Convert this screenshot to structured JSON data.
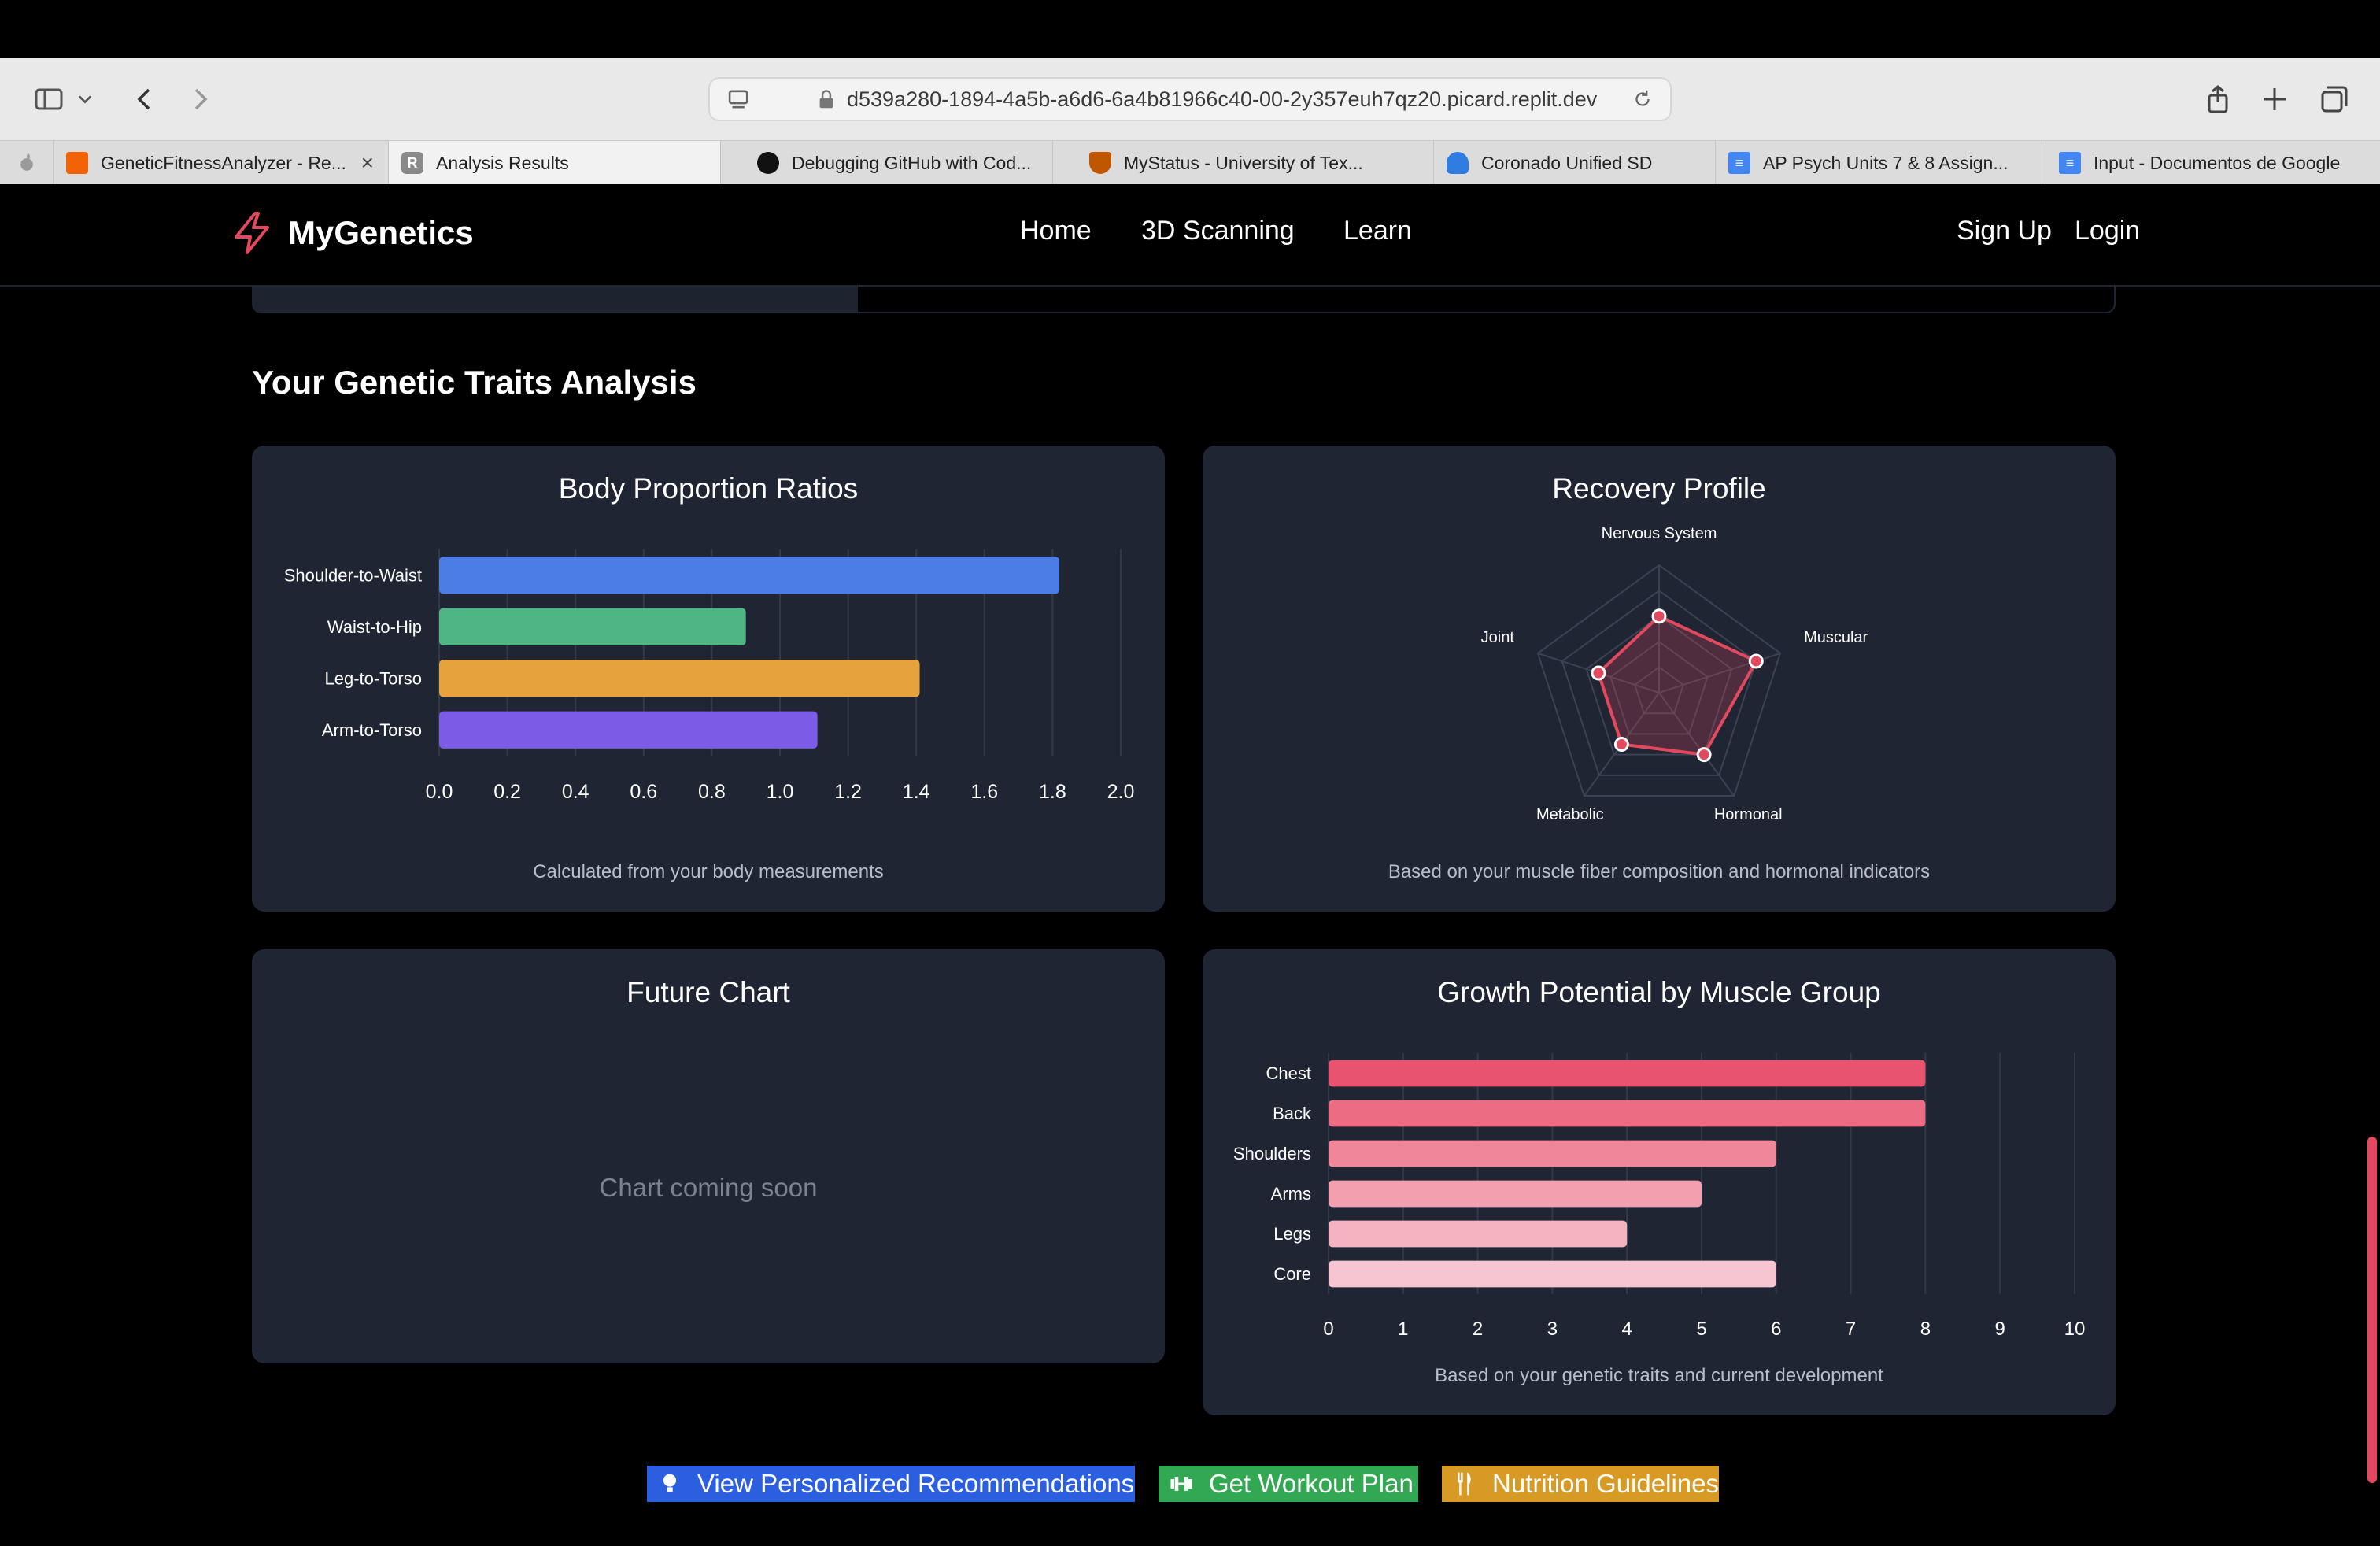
{
  "browser": {
    "url": "d539a280-1894-4a5b-a6d6-6a4b81966c40-00-2y357euh7qz20.picard.replit.dev",
    "tabs": [
      {
        "label": "GeneticFitnessAnalyzer - Re...",
        "favicon": "replit-icon",
        "color": "#f26207"
      },
      {
        "label": "Analysis Results",
        "favicon": "r-icon",
        "color": "#8a8a8a"
      },
      {
        "label": "Debugging GitHub with Cod...",
        "favicon": "openai-icon",
        "color": "#111111"
      },
      {
        "label": "MyStatus - University of Tex...",
        "favicon": "shield-icon",
        "color": "#bf5700"
      },
      {
        "label": "Coronado Unified SD",
        "favicon": "cloud-icon",
        "color": "#2f7de1"
      },
      {
        "label": "AP Psych Units 7 & 8 Assign...",
        "favicon": "docs-icon",
        "color": "#4285f4"
      },
      {
        "label": "Input - Documentos de Google",
        "favicon": "docs-icon",
        "color": "#4285f4"
      }
    ]
  },
  "nav": {
    "brand": "MyGenetics",
    "links": {
      "home": "Home",
      "scanning": "3D Scanning",
      "learn": "Learn",
      "signup": "Sign Up",
      "login": "Login"
    },
    "accent": "#e2495e"
  },
  "section_title": "Your Genetic Traits Analysis",
  "cards": {
    "body": {
      "title": "Body Proportion Ratios",
      "caption": "Calculated from your body measurements"
    },
    "recovery": {
      "title": "Recovery Profile",
      "caption": "Based on your muscle fiber composition and hormonal indicators"
    },
    "future": {
      "title": "Future Chart",
      "placeholder": "Chart coming soon"
    },
    "growth": {
      "title": "Growth Potential by Muscle Group",
      "caption": "Based on your genetic traits and current development"
    }
  },
  "chart_data": [
    {
      "id": "body-proportions",
      "type": "bar",
      "orientation": "horizontal",
      "categories": [
        "Shoulder-to-Waist",
        "Waist-to-Hip",
        "Leg-to-Torso",
        "Arm-to-Torso"
      ],
      "values": [
        1.82,
        0.9,
        1.41,
        1.11
      ],
      "colors": [
        "#4c7ce6",
        "#4fb584",
        "#e6a23c",
        "#7c5be6"
      ],
      "xlim": [
        0,
        2.0
      ],
      "ticks": [
        "0.0",
        "0.2",
        "0.4",
        "0.6",
        "0.8",
        "1.0",
        "1.2",
        "1.4",
        "1.6",
        "1.8",
        "2.0"
      ],
      "grid": true
    },
    {
      "id": "recovery-profile",
      "type": "radar",
      "axes": [
        "Nervous System",
        "Muscular",
        "Hormonal",
        "Metabolic",
        "Joint"
      ],
      "values": [
        6,
        8,
        6,
        5,
        5
      ],
      "max": 10,
      "color": "#e2495e"
    },
    {
      "id": "growth-potential",
      "type": "bar",
      "orientation": "horizontal",
      "categories": [
        "Chest",
        "Back",
        "Shoulders",
        "Arms",
        "Legs",
        "Core"
      ],
      "values": [
        8,
        8,
        6,
        5,
        4,
        6
      ],
      "colors": [
        "#e8536f",
        "#ec6c84",
        "#ef869a",
        "#f29fb0",
        "#f4b3c1",
        "#f6c5d1"
      ],
      "xlim": [
        0,
        10
      ],
      "ticks": [
        "0",
        "1",
        "2",
        "3",
        "4",
        "5",
        "6",
        "7",
        "8",
        "9",
        "10"
      ],
      "grid": true
    }
  ],
  "actions": {
    "recommendations": "View Personalized Recommendations",
    "workout": "Get Workout Plan",
    "nutrition": "Nutrition Guidelines"
  }
}
